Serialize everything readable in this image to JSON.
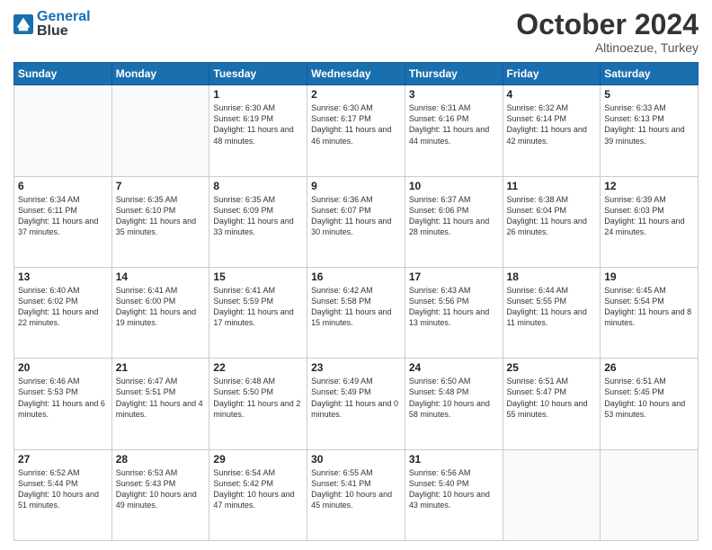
{
  "header": {
    "logo_general": "General",
    "logo_blue": "Blue",
    "month": "October 2024",
    "location": "Altinoezue, Turkey"
  },
  "weekdays": [
    "Sunday",
    "Monday",
    "Tuesday",
    "Wednesday",
    "Thursday",
    "Friday",
    "Saturday"
  ],
  "weeks": [
    [
      {
        "day": null,
        "info": null
      },
      {
        "day": null,
        "info": null
      },
      {
        "day": "1",
        "info": "Sunrise: 6:30 AM\nSunset: 6:19 PM\nDaylight: 11 hours and 48 minutes."
      },
      {
        "day": "2",
        "info": "Sunrise: 6:30 AM\nSunset: 6:17 PM\nDaylight: 11 hours and 46 minutes."
      },
      {
        "day": "3",
        "info": "Sunrise: 6:31 AM\nSunset: 6:16 PM\nDaylight: 11 hours and 44 minutes."
      },
      {
        "day": "4",
        "info": "Sunrise: 6:32 AM\nSunset: 6:14 PM\nDaylight: 11 hours and 42 minutes."
      },
      {
        "day": "5",
        "info": "Sunrise: 6:33 AM\nSunset: 6:13 PM\nDaylight: 11 hours and 39 minutes."
      }
    ],
    [
      {
        "day": "6",
        "info": "Sunrise: 6:34 AM\nSunset: 6:11 PM\nDaylight: 11 hours and 37 minutes."
      },
      {
        "day": "7",
        "info": "Sunrise: 6:35 AM\nSunset: 6:10 PM\nDaylight: 11 hours and 35 minutes."
      },
      {
        "day": "8",
        "info": "Sunrise: 6:35 AM\nSunset: 6:09 PM\nDaylight: 11 hours and 33 minutes."
      },
      {
        "day": "9",
        "info": "Sunrise: 6:36 AM\nSunset: 6:07 PM\nDaylight: 11 hours and 30 minutes."
      },
      {
        "day": "10",
        "info": "Sunrise: 6:37 AM\nSunset: 6:06 PM\nDaylight: 11 hours and 28 minutes."
      },
      {
        "day": "11",
        "info": "Sunrise: 6:38 AM\nSunset: 6:04 PM\nDaylight: 11 hours and 26 minutes."
      },
      {
        "day": "12",
        "info": "Sunrise: 6:39 AM\nSunset: 6:03 PM\nDaylight: 11 hours and 24 minutes."
      }
    ],
    [
      {
        "day": "13",
        "info": "Sunrise: 6:40 AM\nSunset: 6:02 PM\nDaylight: 11 hours and 22 minutes."
      },
      {
        "day": "14",
        "info": "Sunrise: 6:41 AM\nSunset: 6:00 PM\nDaylight: 11 hours and 19 minutes."
      },
      {
        "day": "15",
        "info": "Sunrise: 6:41 AM\nSunset: 5:59 PM\nDaylight: 11 hours and 17 minutes."
      },
      {
        "day": "16",
        "info": "Sunrise: 6:42 AM\nSunset: 5:58 PM\nDaylight: 11 hours and 15 minutes."
      },
      {
        "day": "17",
        "info": "Sunrise: 6:43 AM\nSunset: 5:56 PM\nDaylight: 11 hours and 13 minutes."
      },
      {
        "day": "18",
        "info": "Sunrise: 6:44 AM\nSunset: 5:55 PM\nDaylight: 11 hours and 11 minutes."
      },
      {
        "day": "19",
        "info": "Sunrise: 6:45 AM\nSunset: 5:54 PM\nDaylight: 11 hours and 8 minutes."
      }
    ],
    [
      {
        "day": "20",
        "info": "Sunrise: 6:46 AM\nSunset: 5:53 PM\nDaylight: 11 hours and 6 minutes."
      },
      {
        "day": "21",
        "info": "Sunrise: 6:47 AM\nSunset: 5:51 PM\nDaylight: 11 hours and 4 minutes."
      },
      {
        "day": "22",
        "info": "Sunrise: 6:48 AM\nSunset: 5:50 PM\nDaylight: 11 hours and 2 minutes."
      },
      {
        "day": "23",
        "info": "Sunrise: 6:49 AM\nSunset: 5:49 PM\nDaylight: 11 hours and 0 minutes."
      },
      {
        "day": "24",
        "info": "Sunrise: 6:50 AM\nSunset: 5:48 PM\nDaylight: 10 hours and 58 minutes."
      },
      {
        "day": "25",
        "info": "Sunrise: 6:51 AM\nSunset: 5:47 PM\nDaylight: 10 hours and 55 minutes."
      },
      {
        "day": "26",
        "info": "Sunrise: 6:51 AM\nSunset: 5:45 PM\nDaylight: 10 hours and 53 minutes."
      }
    ],
    [
      {
        "day": "27",
        "info": "Sunrise: 6:52 AM\nSunset: 5:44 PM\nDaylight: 10 hours and 51 minutes."
      },
      {
        "day": "28",
        "info": "Sunrise: 6:53 AM\nSunset: 5:43 PM\nDaylight: 10 hours and 49 minutes."
      },
      {
        "day": "29",
        "info": "Sunrise: 6:54 AM\nSunset: 5:42 PM\nDaylight: 10 hours and 47 minutes."
      },
      {
        "day": "30",
        "info": "Sunrise: 6:55 AM\nSunset: 5:41 PM\nDaylight: 10 hours and 45 minutes."
      },
      {
        "day": "31",
        "info": "Sunrise: 6:56 AM\nSunset: 5:40 PM\nDaylight: 10 hours and 43 minutes."
      },
      {
        "day": null,
        "info": null
      },
      {
        "day": null,
        "info": null
      }
    ]
  ]
}
